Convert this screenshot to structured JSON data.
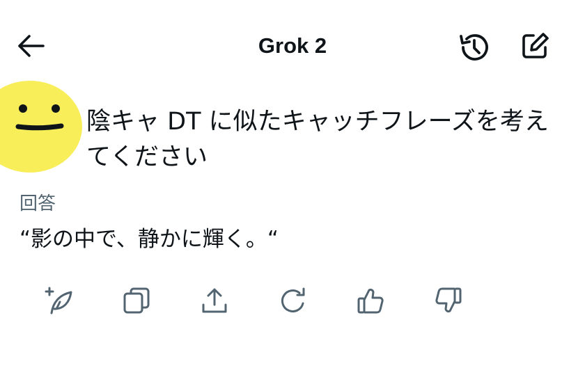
{
  "header": {
    "title": "Grok 2",
    "back_icon": "arrow-left-icon",
    "history_icon": "history-icon",
    "new_chat_icon": "compose-icon"
  },
  "conversation": {
    "user_message": "陰キャ DT に似たキャッチフレーズを考えてください",
    "response_label": "回答",
    "response_text": "“影の中で、静かに輝く。“"
  },
  "actions": [
    {
      "name": "new-post-icon"
    },
    {
      "name": "copy-icon"
    },
    {
      "name": "share-icon"
    },
    {
      "name": "regenerate-icon"
    },
    {
      "name": "thumbs-up-icon"
    },
    {
      "name": "thumbs-down-icon"
    }
  ],
  "colors": {
    "icon": "#536471",
    "avatar": "#f7ee5a",
    "text": "#0f1419"
  }
}
